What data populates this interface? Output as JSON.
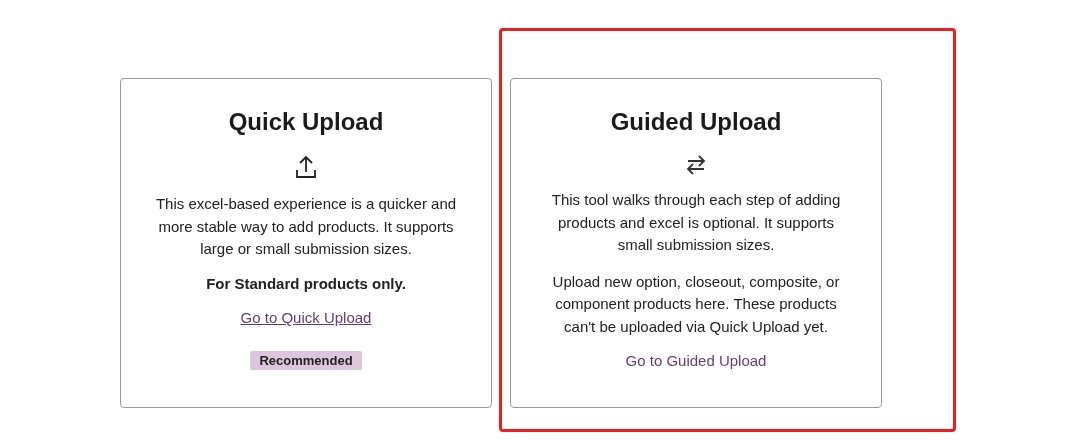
{
  "cards": [
    {
      "title": "Quick Upload",
      "kind": "upload",
      "highlighted": false,
      "paragraphs": [
        {
          "kind": "text",
          "text": "This excel-based experience is a quicker and more stable way to add products. It supports large or small submission sizes."
        },
        {
          "kind": "bold",
          "text": "For Standard products only."
        }
      ],
      "link": {
        "label": "Go to Quick Upload",
        "underlined": true
      },
      "badge": "Recommended"
    },
    {
      "title": "Guided Upload",
      "kind": "swap",
      "highlighted": true,
      "paragraphs": [
        {
          "kind": "text",
          "text": "This tool walks through each step of adding products and excel is optional. It supports small submission sizes."
        },
        {
          "kind": "text",
          "text": "Upload new option, closeout, composite, or component products here. These products can't be uploaded via Quick Upload yet."
        }
      ],
      "link": {
        "label": "Go to Guided Upload",
        "underlined": false
      }
    }
  ]
}
